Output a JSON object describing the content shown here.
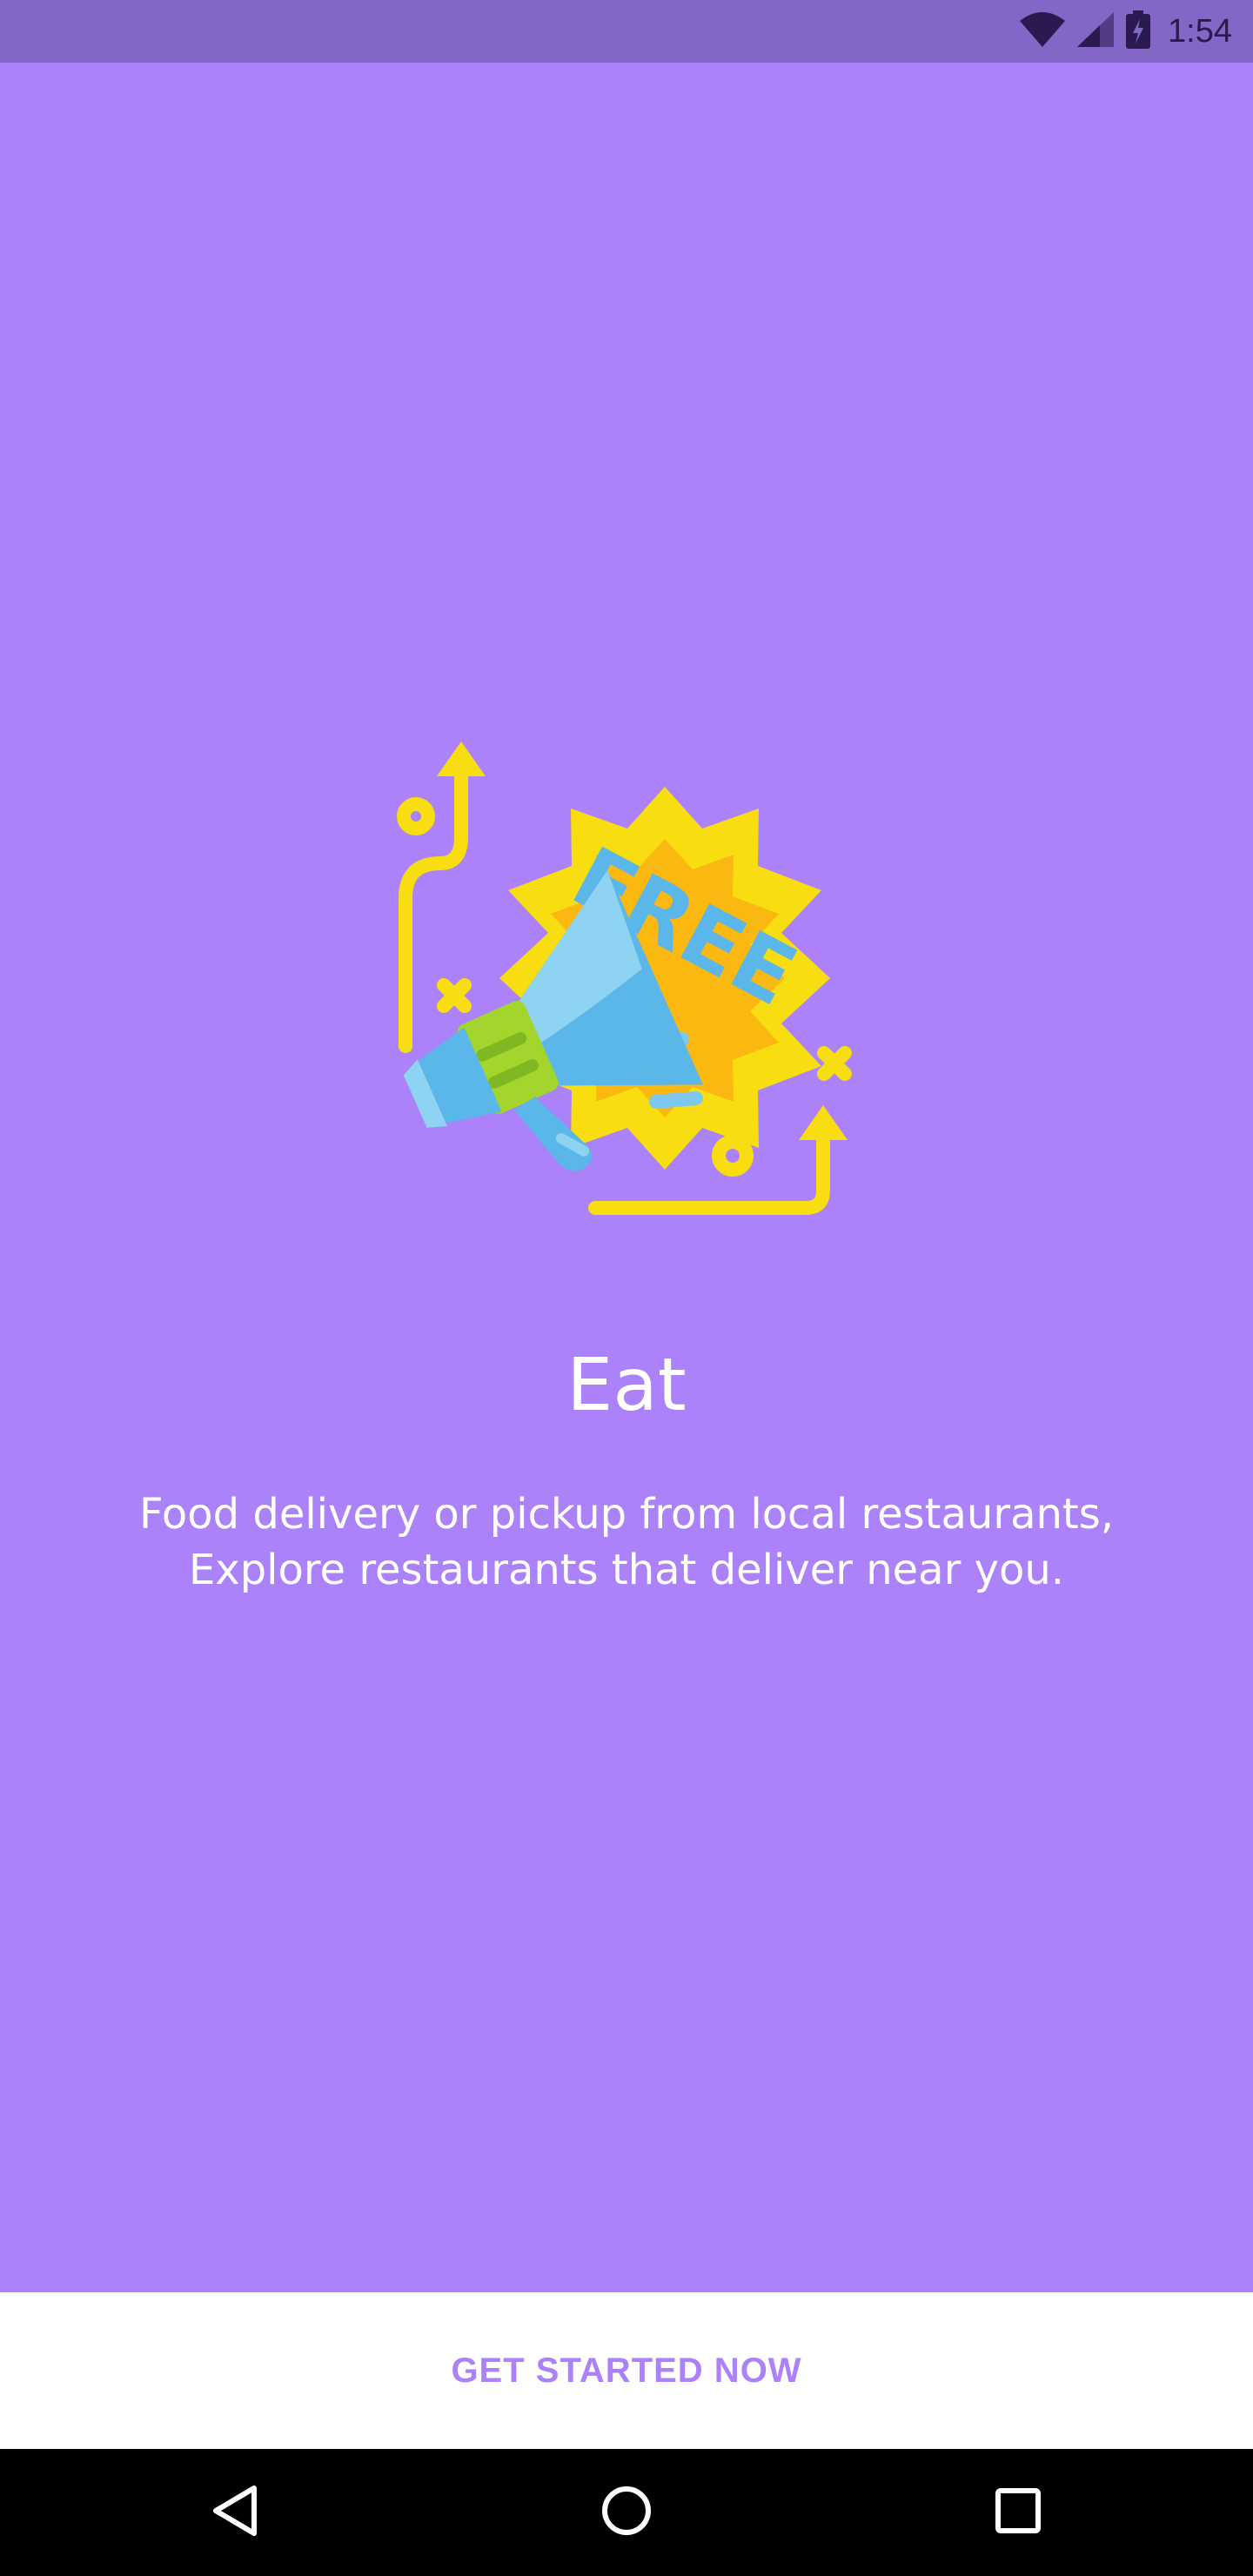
{
  "status_bar": {
    "time": "1:54",
    "icons": [
      "wifi-icon",
      "cellular-signal-icon",
      "battery-charging-icon"
    ]
  },
  "onboarding": {
    "illustration": "megaphone-free-icon",
    "illustration_text": "FREE",
    "title": "Eat",
    "description_lines": [
      "Food delivery or pickup from local restaurants,",
      "Explore restaurants that deliver near you."
    ]
  },
  "cta": {
    "label": "GET STARTED NOW"
  },
  "nav_bar": {
    "icons": [
      "back-icon",
      "home-icon",
      "recents-icon"
    ]
  },
  "colors": {
    "background": "#ab82fa",
    "status_bar": "#8466c6",
    "accent": "#ab82fa",
    "white": "#ffffff",
    "star_outer": "#f8dd10",
    "star_inner": "#fbb810",
    "megaphone_blue": "#5bb6ea",
    "megaphone_green": "#a3d52d"
  }
}
